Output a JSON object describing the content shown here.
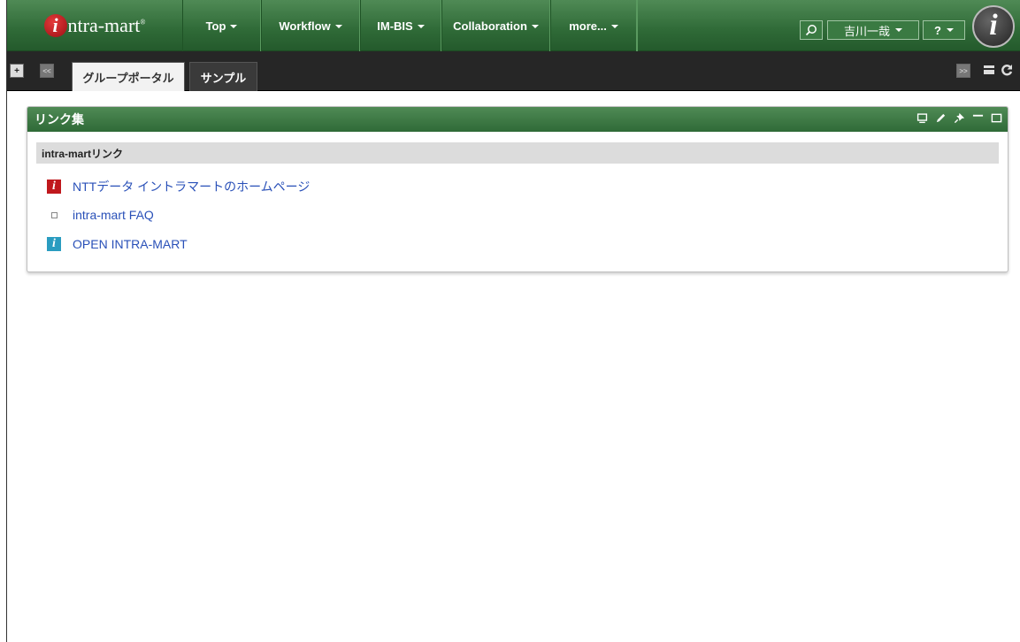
{
  "header": {
    "logo_mark": "i",
    "logo_text": "ntra-mart",
    "logo_reg": "®",
    "nav": [
      {
        "label": "Top"
      },
      {
        "label": "Workflow"
      },
      {
        "label": "IM-BIS"
      },
      {
        "label": "Collaboration"
      },
      {
        "label": "more..."
      }
    ],
    "user_name": "吉川一哉",
    "help_label": "?",
    "brand_mark": "i"
  },
  "tabbar": {
    "add_label": "+",
    "prev_label": "<<",
    "next_label": ">>",
    "tabs": [
      {
        "label": "グループポータル",
        "active": true
      },
      {
        "label": "サンプル",
        "active": false
      }
    ]
  },
  "portlet": {
    "title": "リンク集",
    "section_title": "intra-martリンク",
    "links": [
      {
        "label": "NTTデータ イントラマートのホームページ",
        "icon": "intra-mart-red-icon"
      },
      {
        "label": "intra-mart FAQ",
        "icon": "small-square-icon"
      },
      {
        "label": "OPEN INTRA-MART",
        "icon": "intra-mart-teal-icon"
      }
    ]
  },
  "colors": {
    "header_green": "#2f6a37",
    "tabbar_dark": "#262626",
    "link_blue": "#2950b8"
  }
}
